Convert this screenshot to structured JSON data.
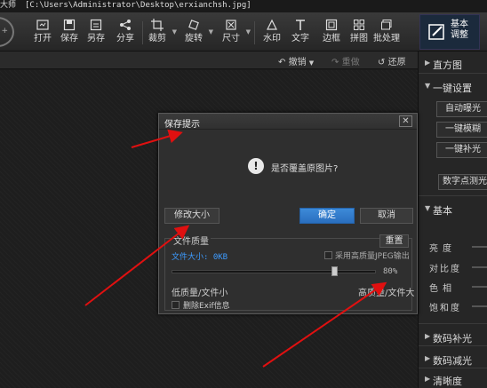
{
  "titlebar": {
    "app_fragment": "大师",
    "path": "[C:\\Users\\Administrator\\Desktop\\erxianchsh.jpg]"
  },
  "toolbar": {
    "open": "打开",
    "save": "保存",
    "save_as": "另存",
    "share": "分享",
    "crop": "裁剪",
    "rotate": "旋转",
    "size": "尺寸",
    "watermark": "水印",
    "text": "文字",
    "border": "边框",
    "collage": "拼图",
    "batch": "批处理",
    "basic_adjust": "基本调整"
  },
  "subbar": {
    "undo": "撤销",
    "redo": "重做",
    "restore": "还原"
  },
  "right_panel": {
    "histogram": "直方图",
    "one_click": "一键设置",
    "auto_exposure": "自动曝光",
    "one_click_blur": "一键模糊",
    "one_click_fill": "一键补光",
    "digital_metering": "数字点测光",
    "basic": "基本",
    "brightness": "亮度",
    "contrast": "对比度",
    "hue": "色相",
    "saturation": "饱和度",
    "digital_fill": "数码补光",
    "digital_reduce": "数码减光",
    "sharpness": "清晰度"
  },
  "dialog": {
    "title": "保存提示",
    "close": "✕",
    "question_icon": "!",
    "question": "是否覆盖原图片?",
    "modify_size": "修改大小",
    "confirm": "确定",
    "cancel": "取消",
    "quality_title": "文件质量",
    "reset": "重置",
    "file_size": "文件大小: 0KB",
    "high_quality_jpeg": "采用高质量JPEG输出",
    "quality_fraction": 0.8,
    "quality_pct": "80%",
    "low_quality": "低质量/文件小",
    "high_quality": "高质量/文件大",
    "delete_exif": "删除Exif信息"
  },
  "colors": {
    "primary": "#2f7fd0",
    "accent_blue": "#3d9bff",
    "annotation": "#e01010"
  }
}
